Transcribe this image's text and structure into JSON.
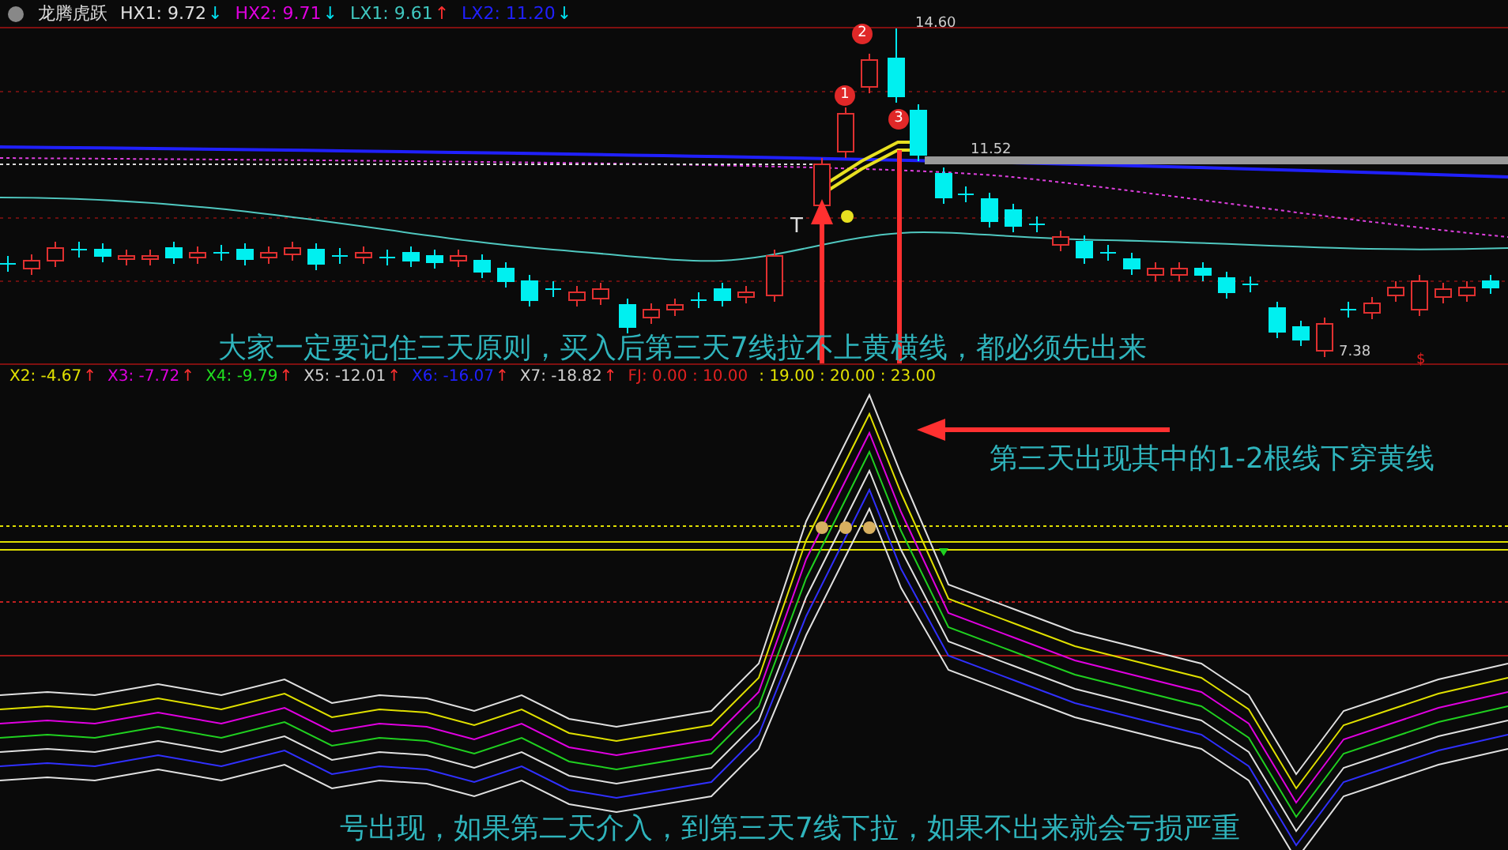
{
  "header": {
    "title": "龙腾虎跃",
    "indicators": [
      {
        "label": "HX1: 9.72",
        "color": "#e0e0e0",
        "arrow": {
          "text": "↓",
          "color": "#00e0f0"
        }
      },
      {
        "label": "HX2: 9.71",
        "color": "#e000e0",
        "arrow": {
          "text": "↓",
          "color": "#00e0f0"
        }
      },
      {
        "label": "LX1: 9.61",
        "color": "#40c8c0",
        "arrow": {
          "text": "↑",
          "color": "#ff3030"
        }
      },
      {
        "label": "LX2: 11.20",
        "color": "#2020ff",
        "arrow": {
          "text": "↓",
          "color": "#00e0f0"
        }
      }
    ]
  },
  "price_chart": {
    "high_label": "14.60",
    "low_label": "7.38",
    "line_label": "11.52",
    "side_mark": "$",
    "t_mark": "T",
    "markers": [
      "1",
      "2",
      "3"
    ],
    "note": "大家一定要记住三天原则，买入后第三天7线拉不上黄横线，都必须先出来"
  },
  "indicator_legend": {
    "items": [
      {
        "label": "X2: -4.67",
        "color": "#e0e000",
        "arrow": {
          "text": "↑",
          "color": "#ff3030"
        }
      },
      {
        "label": "X3: -7.72",
        "color": "#e000e0",
        "arrow": {
          "text": "↑",
          "color": "#ff3030"
        }
      },
      {
        "label": "X4: -9.79",
        "color": "#20e020",
        "arrow": {
          "text": "↑",
          "color": "#ff3030"
        }
      },
      {
        "label": "X5: -12.01",
        "color": "#d0d0d0",
        "arrow": {
          "text": "↑",
          "color": "#ff3030"
        }
      },
      {
        "label": "X6: -16.07",
        "color": "#2020ff",
        "arrow": {
          "text": "↑",
          "color": "#ff3030"
        }
      },
      {
        "label": "X7: -18.82",
        "color": "#d0d0d0",
        "arrow": {
          "text": "↑",
          "color": "#ff3030"
        }
      }
    ],
    "fj_parts": [
      {
        "text": "FJ: 0.00 : 10.00",
        "color": "#e02020"
      },
      {
        "text": ": 19.00 : 20.00 : 23.00",
        "color": "#e0e000"
      }
    ]
  },
  "indicator_chart": {
    "note": "第三天出现其中的1-2根线下穿黄线",
    "bottom_note": "号出现，如果第二天介入，到第三天7线下拉，如果不出来就会亏损严重"
  }
}
